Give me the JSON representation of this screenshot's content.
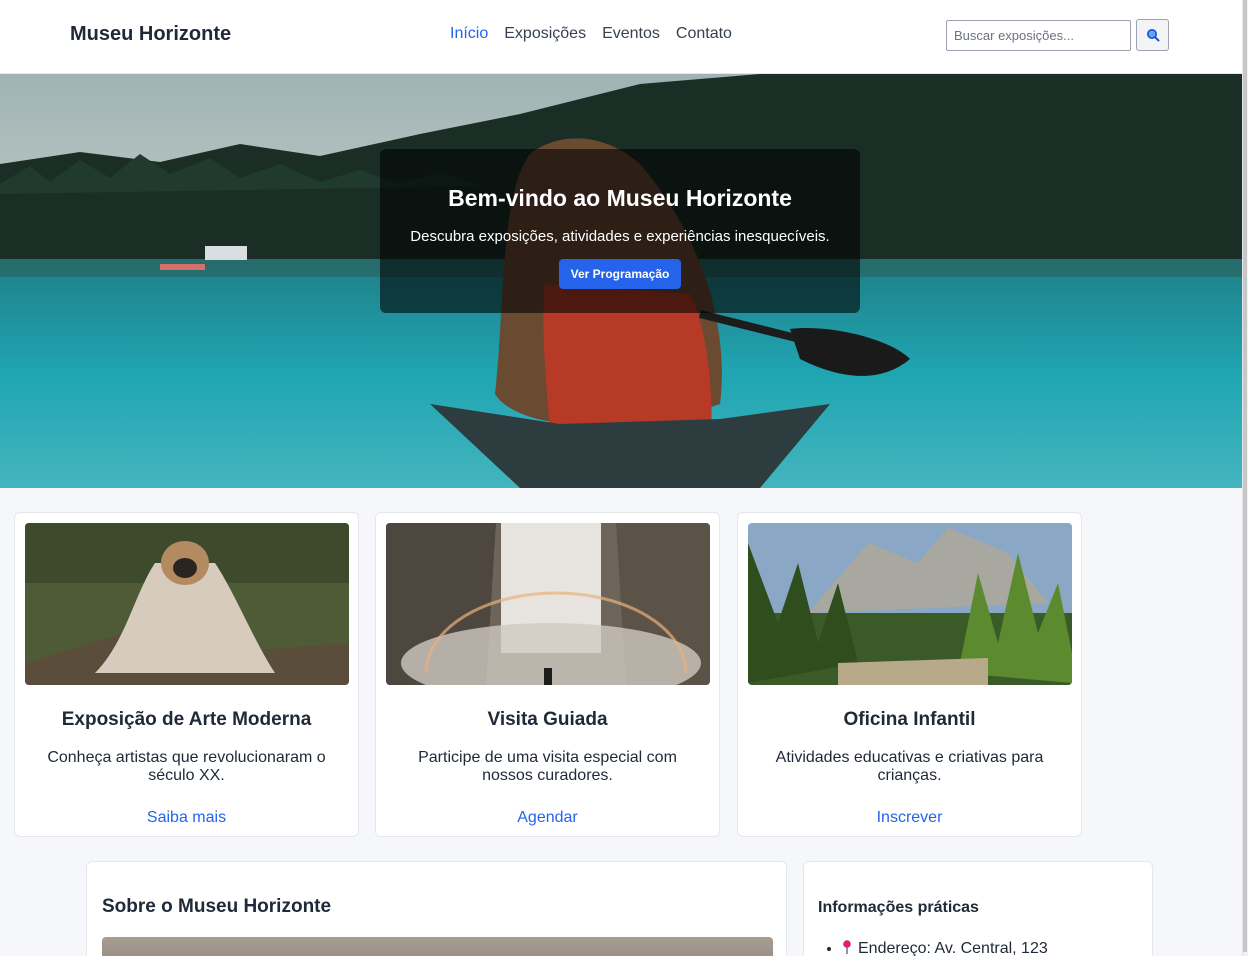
{
  "header": {
    "logo": "Museu Horizonte",
    "nav": [
      {
        "label": "Início",
        "active": true
      },
      {
        "label": "Exposições",
        "active": false
      },
      {
        "label": "Eventos",
        "active": false
      },
      {
        "label": "Contato",
        "active": false
      }
    ],
    "search": {
      "placeholder": "Buscar exposições...",
      "button_icon": "search-icon"
    }
  },
  "hero": {
    "title": "Bem-vindo ao Museu Horizonte",
    "subtitle": "Descubra exposições, atividades e experiências inesquecíveis.",
    "button_label": "Ver Programação"
  },
  "cards": [
    {
      "title": "Exposição de Arte Moderna",
      "description": "Conheça artistas que revolucionaram o século XX.",
      "link": "Saiba mais"
    },
    {
      "title": "Visita Guiada",
      "description": "Participe de uma visita especial com nossos curadores.",
      "link": "Agendar"
    },
    {
      "title": "Oficina Infantil",
      "description": "Atividades educativas e criativas para crianças.",
      "link": "Inscrever"
    }
  ],
  "about": {
    "title": "Sobre o Museu Horizonte"
  },
  "info": {
    "title": "Informações práticas",
    "items": [
      {
        "icon": "pin-icon",
        "text": "Endereço: Av. Central, 123"
      }
    ]
  },
  "colors": {
    "accent": "#2563eb",
    "text": "#1f2937",
    "background": "#f5f7fa"
  }
}
